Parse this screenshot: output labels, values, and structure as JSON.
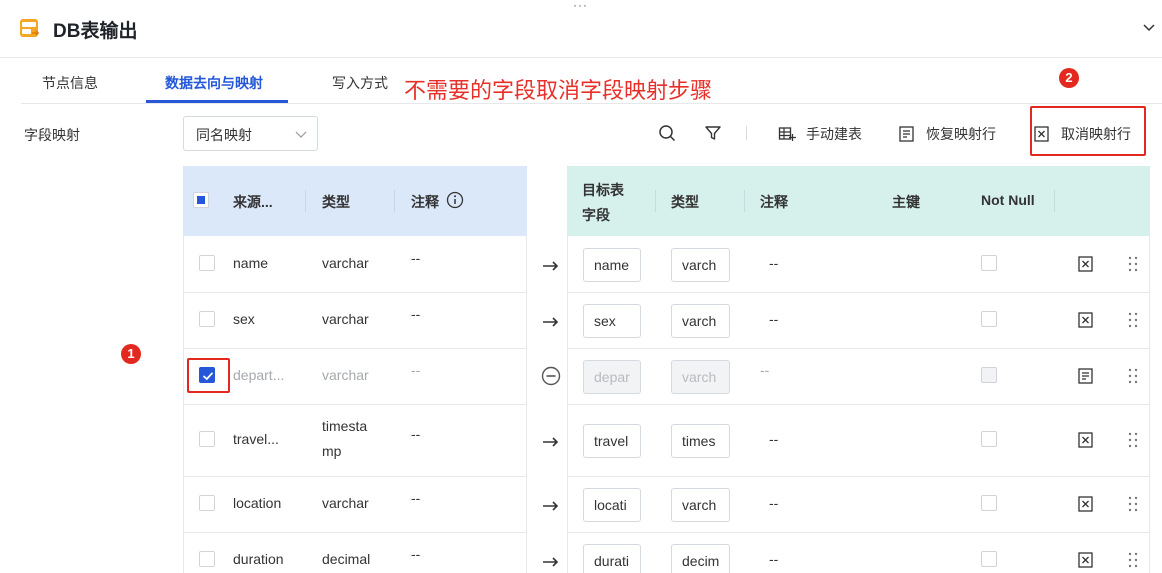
{
  "header": {
    "dots": "···",
    "title": "DB表输出"
  },
  "tabs": [
    {
      "label": "节点信息"
    },
    {
      "label": "数据去向与映射"
    },
    {
      "label": "写入方式"
    }
  ],
  "annotation": {
    "text": "不需要的字段取消字段映射步骤",
    "badge1": "1",
    "badge2": "2",
    "color": "#e3291f"
  },
  "mapping": {
    "label": "字段映射",
    "select_value": "同名映射"
  },
  "toolbar": {
    "manual_label": "手动建表",
    "restore_label": "恢复映射行",
    "cancel_label": "取消映射行"
  },
  "source_headers": {
    "name": "来源...",
    "type": "类型",
    "comment": "注释"
  },
  "target_headers": {
    "field_line1": "目标表",
    "field_line2": "字段",
    "type": "类型",
    "comment": "注释",
    "pk": "主键",
    "notnull": "Not Null"
  },
  "rows": [
    {
      "src_name": "name",
      "src_type": "varchar",
      "src_comment": "--",
      "tgt_field": "name",
      "tgt_type": "varch",
      "tgt_comment": "--",
      "checked": false,
      "mapped": true
    },
    {
      "src_name": "sex",
      "src_type": "varchar",
      "src_comment": "--",
      "tgt_field": "sex",
      "tgt_type": "varch",
      "tgt_comment": "--",
      "checked": false,
      "mapped": true
    },
    {
      "src_name": "depart...",
      "src_type": "varchar",
      "src_comment": "--",
      "tgt_field": "depar",
      "tgt_type": "varch",
      "tgt_comment": "--",
      "checked": true,
      "mapped": false
    },
    {
      "src_name": "travel...",
      "src_type_line1": "timesta",
      "src_type_line2": "mp",
      "src_comment": "--",
      "tgt_field": "travel",
      "tgt_type": "times",
      "tgt_comment": "--",
      "checked": false,
      "mapped": true
    },
    {
      "src_name": "location",
      "src_type": "varchar",
      "src_comment": "--",
      "tgt_field": "locati",
      "tgt_type": "varch",
      "tgt_comment": "--",
      "checked": false,
      "mapped": true
    },
    {
      "src_name": "duration",
      "src_type": "decimal",
      "src_comment": "--",
      "tgt_field": "durati",
      "tgt_type": "decim",
      "tgt_comment": "--",
      "checked": false,
      "mapped": true
    }
  ],
  "colors": {
    "accent": "#2458d8",
    "source_header_bg": "#dbe8fa",
    "target_header_bg": "#d6f0ec"
  }
}
